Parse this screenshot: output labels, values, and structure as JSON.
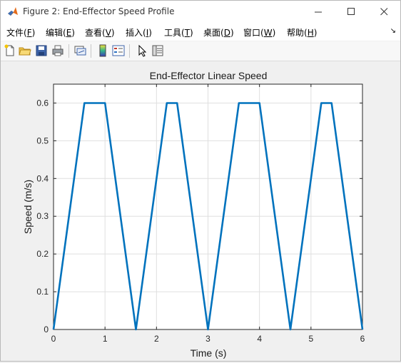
{
  "window": {
    "title": "Figure 2: End-Effector Speed Profile",
    "minimize_glyph": "—",
    "maximize_glyph": "☐",
    "close_glyph": "✕"
  },
  "menu": [
    {
      "text": "文件(",
      "key": "F",
      "end": ")"
    },
    {
      "text": "编辑(",
      "key": "E",
      "end": ")"
    },
    {
      "text": "查看(",
      "key": "V",
      "end": ")"
    },
    {
      "text": "插入(",
      "key": "I",
      "end": ")"
    },
    {
      "text": "工具(",
      "key": "T",
      "end": ")"
    },
    {
      "text": "桌面(",
      "key": "D",
      "end": ")"
    },
    {
      "text": "窗口(",
      "key": "W",
      "end": ")"
    },
    {
      "text": "帮助(",
      "key": "H",
      "end": ")"
    }
  ],
  "menu_overflow_glyph": "↘",
  "toolbar_icons": [
    "new-figure-icon",
    "open-file-icon",
    "save-icon",
    "print-icon",
    "link-plot-icon",
    "colorbar-icon",
    "legend-icon",
    "edit-plot-arrow-icon",
    "property-inspector-icon"
  ],
  "colors": {
    "line": "#0072BD",
    "grid": "#dfdfdf",
    "axes_bg": "#ffffff"
  },
  "chart_data": {
    "type": "line",
    "title": "End-Effector Linear Speed",
    "xlabel": "Time (s)",
    "ylabel": "Speed (m/s)",
    "xlim": [
      0,
      6
    ],
    "ylim": [
      0,
      0.65
    ],
    "xticks": [
      0,
      1,
      2,
      3,
      4,
      5,
      6
    ],
    "yticks": [
      0,
      0.1,
      0.2,
      0.3,
      0.4,
      0.5,
      0.6
    ],
    "grid": true,
    "series": [
      {
        "x": [
          0,
          0.6,
          1.0,
          1.6,
          2.2,
          2.4,
          3.0,
          3.6,
          4.0,
          4.6,
          5.2,
          5.4,
          6.0
        ],
        "y": [
          0,
          0.6,
          0.6,
          0,
          0.6,
          0.6,
          0,
          0.6,
          0.6,
          0,
          0.6,
          0.6,
          0
        ]
      }
    ]
  }
}
